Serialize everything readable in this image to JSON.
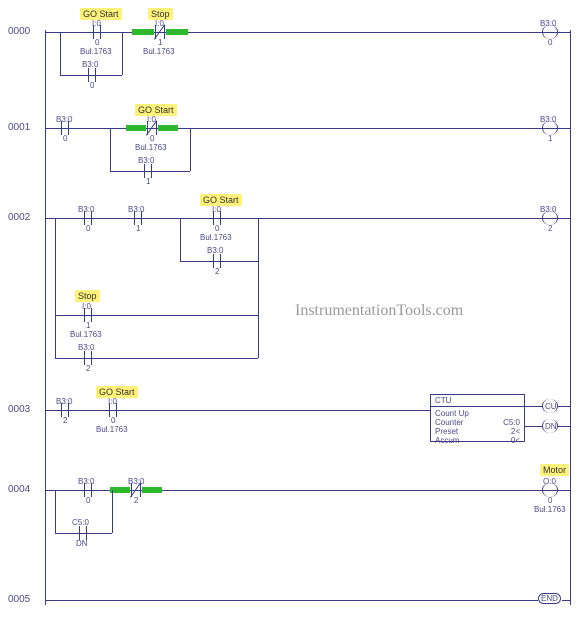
{
  "watermark": "InstrumentationTools.com",
  "rungs": [
    "0000",
    "0001",
    "0002",
    "0003",
    "0004",
    "0005"
  ],
  "labels": {
    "go_start": "GO Start",
    "stop": "Stop",
    "motor": "Motor"
  },
  "addr": {
    "i0": "I:0",
    "b30": "B3:0",
    "c50": "C5:0",
    "o0": "O:0",
    "bul": "Bul.1763"
  },
  "bits": {
    "b0": "0",
    "b1": "1",
    "b2": "2"
  },
  "counter": {
    "title": "CTU",
    "l1": "Count Up",
    "l2": "Counter",
    "l3": "Preset",
    "l4": "Accum",
    "v2": "C5:0",
    "v3": "2<",
    "v4": "0<",
    "cu": "CU",
    "dn": "DN",
    "dn2": "DN"
  },
  "end": "END"
}
